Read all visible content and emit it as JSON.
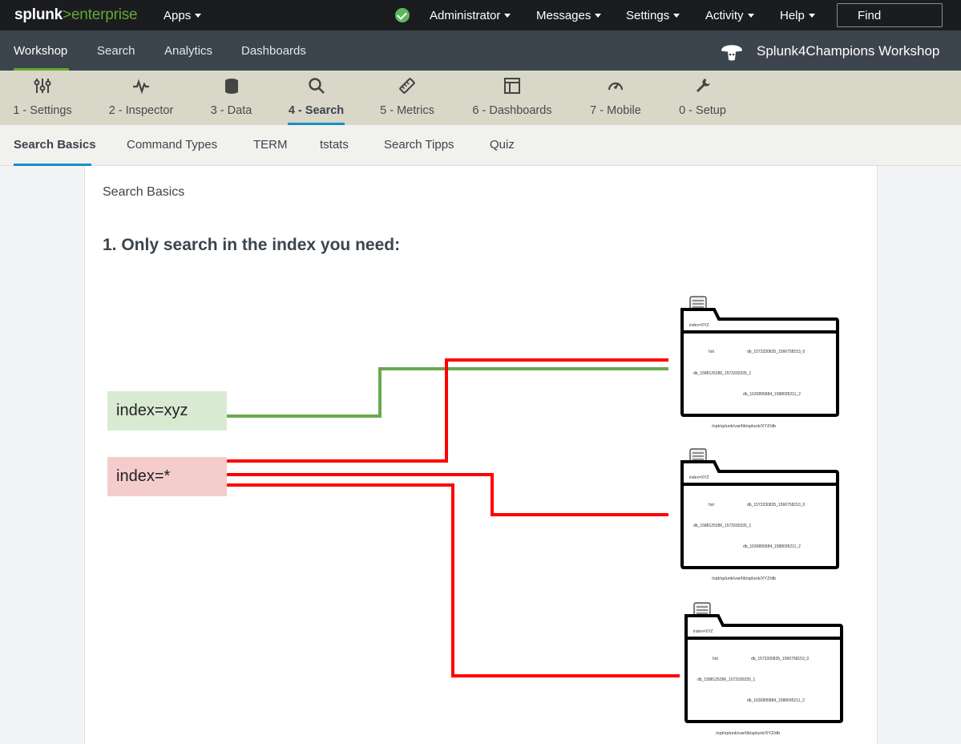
{
  "topbar": {
    "logo": {
      "part1": "splunk",
      "part2": ">",
      "part3": "enterprise"
    },
    "menus": [
      "Apps",
      "Administrator",
      "Messages",
      "Settings",
      "Activity",
      "Help"
    ],
    "find_label": "Find",
    "status_icon": "check-circle-icon",
    "status_color": "#5cb85c"
  },
  "appbar": {
    "nav": [
      "Workshop",
      "Search",
      "Analytics",
      "Dashboards"
    ],
    "active": "Workshop",
    "app_title": "Splunk4Champions Workshop",
    "accent": "#65a637"
  },
  "icontabs": [
    {
      "label": "1 - Settings",
      "icon": "sliders-icon"
    },
    {
      "label": "2 - Inspector",
      "icon": "pulse-icon"
    },
    {
      "label": "3 - Data",
      "icon": "database-icon"
    },
    {
      "label": "4 - Search",
      "icon": "search-icon"
    },
    {
      "label": "5 - Metrics",
      "icon": "ruler-icon"
    },
    {
      "label": "6 - Dashboards",
      "icon": "layout-icon"
    },
    {
      "label": "7 - Mobile",
      "icon": "gauge-icon"
    },
    {
      "label": "0 - Setup",
      "icon": "wrench-icon"
    }
  ],
  "subtabs": [
    "Search Basics",
    "Command Types",
    "TERM",
    "tstats",
    "Search Tipps",
    "Quiz"
  ],
  "panel": {
    "title": "Search Basics",
    "heading": "1. Only search in the index you need:"
  },
  "diagram": {
    "index_specific": "index=xyz",
    "index_all": "index=*",
    "folder_tab_label": "index=XYZ",
    "bucket_labels": [
      "hot",
      "db_1573330835_1566758153_0",
      "db_1588125286_1573330335_1",
      "db_1630895884_1588095211_2"
    ],
    "folder_path": "/opt/splunk/var/lib/splunk/XYZ/db",
    "colors": {
      "green": "#6aa84f",
      "red": "#ff0000",
      "specific_bg": "#d9ead3",
      "all_bg": "#f4cccc"
    }
  }
}
